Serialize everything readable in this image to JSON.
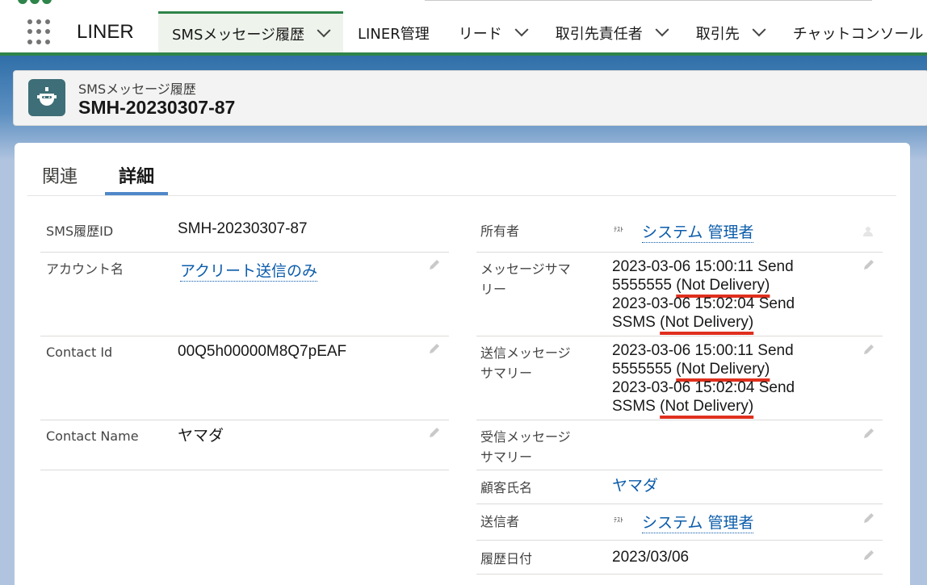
{
  "nav": {
    "app_name": "LINER",
    "tabs": [
      {
        "label": "SMSメッセージ履歴"
      },
      {
        "label": "LINER管理"
      },
      {
        "label": "リード"
      },
      {
        "label": "取引先責任者"
      },
      {
        "label": "取引先"
      },
      {
        "label": "チャットコンソール"
      }
    ]
  },
  "header": {
    "object_label": "SMSメッセージ履歴",
    "record_title": "SMH-20230307-87"
  },
  "detail_tabs": {
    "related": "関連",
    "details": "詳細"
  },
  "left_fields": [
    {
      "label": "SMS履歴ID",
      "value": "SMH-20230307-87"
    },
    {
      "label": "アカウント名",
      "value": "アクリート送信のみ"
    },
    {
      "label": "Contact Id",
      "value": "00Q5h00000M8Q7pEAF"
    },
    {
      "label": "Contact Name",
      "value": "ヤマダ"
    }
  ],
  "right_fields": {
    "owner": {
      "label": "所有者",
      "badge": "ﾃｽﾄ",
      "value": "システム 管理者"
    },
    "message_summary": {
      "label_line1": "メッセージサマ",
      "label_line2": "リー",
      "lines": [
        {
          "text": "2023-03-06 15:00:11 Send"
        },
        {
          "text": "5555555 ",
          "status": "(Not Delivery)"
        },
        {
          "text": "2023-03-06 15:02:04 Send"
        },
        {
          "text": "SSMS ",
          "status": "(Not Delivery)"
        }
      ]
    },
    "sent_summary": {
      "label_line1": "送信メッセージ",
      "label_line2": "サマリー",
      "lines": [
        {
          "text": "2023-03-06 15:00:11 Send"
        },
        {
          "text": "5555555 ",
          "status": "(Not Delivery)"
        },
        {
          "text": "2023-03-06 15:02:04 Send"
        },
        {
          "text": "SSMS ",
          "status": "(Not Delivery)"
        }
      ]
    },
    "received_summary": {
      "label_line1": "受信メッセージ",
      "label_line2": "サマリー",
      "value": ""
    },
    "customer_name": {
      "label": "顧客氏名",
      "value": "ヤマダ"
    },
    "sender": {
      "label": "送信者",
      "badge": "ﾃｽﾄ",
      "value": "システム 管理者"
    },
    "history_date": {
      "label": "履歴日付",
      "value": "2023/03/06"
    }
  },
  "colors": {
    "accent": "#2e844a",
    "link": "#0b5cab",
    "highlight": "#e0301e",
    "icon_bg": "#3e6e77"
  }
}
